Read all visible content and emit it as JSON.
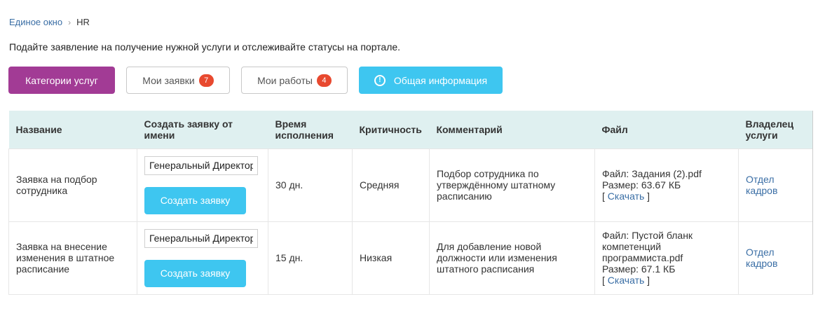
{
  "breadcrumb": {
    "home": "Единое окно",
    "separator": "›",
    "current": "HR"
  },
  "intro": "Подайте заявление на получение нужной услуги и отслеживайте статусы на портале.",
  "buttons": {
    "categories": "Категории услуг",
    "my_requests": "Мои заявки",
    "my_requests_count": "7",
    "my_works": "Мои работы",
    "my_works_count": "4",
    "general_info": "Общая информация"
  },
  "table": {
    "headers": {
      "name": "Название",
      "create_from": "Создать заявку от имени",
      "time": "Время исполнения",
      "criticality": "Критичность",
      "comment": "Комментарий",
      "file": "Файл",
      "owner": "Владелец услуги"
    },
    "rows": [
      {
        "name": "Заявка на подбор сотрудника",
        "create_from_value": "Генеральный Директор",
        "create_button": "Создать заявку",
        "time": "30 дн.",
        "criticality": "Средняя",
        "comment": "Подбор сотрудника по утверждённому штатному расписанию",
        "file_name": "Файл: Задания (2).pdf",
        "file_size": "Размер: 63.67 КБ",
        "download_open": "[ ",
        "download": "Скачать",
        "download_close": " ]",
        "owner": "Отдел кадров"
      },
      {
        "name": "Заявка на внесение изменения в штатное расписание",
        "create_from_value": "Генеральный Директор",
        "create_button": "Создать заявку",
        "time": "15 дн.",
        "criticality": "Низкая",
        "comment": "Для добавление новой должности или изменения штатного расписания",
        "file_name": "Файл: Пустой бланк компетенций программиста.pdf",
        "file_size": "Размер: 67.1 КБ",
        "download_open": "[ ",
        "download": "Скачать",
        "download_close": " ]",
        "owner": "Отдел кадров"
      }
    ]
  },
  "colors": {
    "category_button": "#a23b95",
    "info_button": "#3ec6f0",
    "badge": "#e8492f",
    "header_bg": "#dff0f0",
    "link": "#3a6ea5"
  },
  "icons": {
    "info": "exclamation-circle-icon",
    "breadcrumb_separator": "chevron-right-icon"
  }
}
